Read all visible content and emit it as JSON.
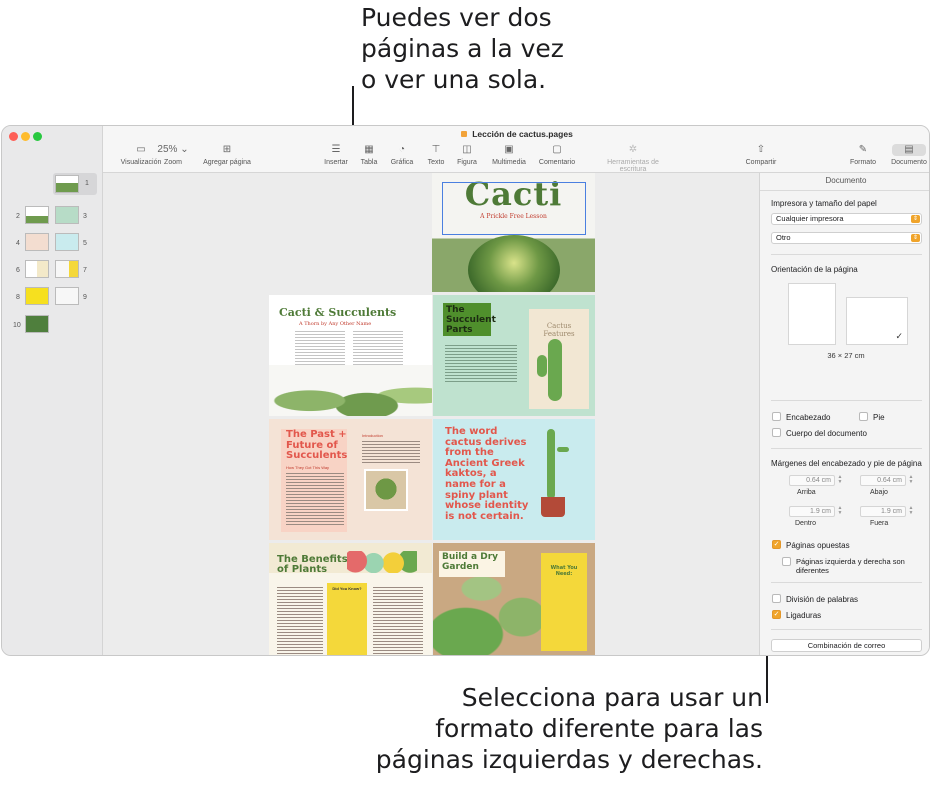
{
  "callouts": {
    "top": "Puedes ver dos\npáginas a la vez\no ver una sola.",
    "bottom": "Selecciona para usar un\nformato diferente para las\npáginas izquierdas y derechas."
  },
  "window": {
    "title": "Lección de cactus.pages",
    "traffic_colors": [
      "#fe5f57",
      "#febc2e",
      "#28c840"
    ]
  },
  "toolbar": {
    "items": [
      {
        "label": "Visualización",
        "icon": "sidebar-icon",
        "glyph": "▭"
      },
      {
        "label": "Zoom",
        "icon": "zoom-dropdown",
        "glyph": "25% ⌄"
      },
      {
        "label": "Agregar página",
        "icon": "add-page-icon",
        "glyph": "⊞"
      },
      {
        "label": "Insertar",
        "icon": "insert-icon",
        "glyph": "☰"
      },
      {
        "label": "Tabla",
        "icon": "table-icon",
        "glyph": "▦"
      },
      {
        "label": "Gráfica",
        "icon": "chart-icon",
        "glyph": "◔"
      },
      {
        "label": "Texto",
        "icon": "text-box-icon",
        "glyph": "⊤"
      },
      {
        "label": "Figura",
        "icon": "shape-icon",
        "glyph": "◫"
      },
      {
        "label": "Multimedia",
        "icon": "media-icon",
        "glyph": "▣"
      },
      {
        "label": "Comentario",
        "icon": "comment-icon",
        "glyph": "▢"
      },
      {
        "label": "Herramientas de escritura",
        "icon": "writing-tools-icon",
        "glyph": "✲",
        "disabled": true
      },
      {
        "label": "Compartir",
        "icon": "share-icon",
        "glyph": "⇧"
      },
      {
        "label": "Formato",
        "icon": "format-brush-icon",
        "glyph": "✎"
      },
      {
        "label": "Documento",
        "icon": "document-icon",
        "glyph": "▤",
        "active": true
      }
    ]
  },
  "sidebar": {
    "page_numbers": [
      "1",
      "2",
      "3",
      "4",
      "5",
      "6",
      "7",
      "8",
      "9",
      "10"
    ]
  },
  "pages": {
    "cover": {
      "title": "Cacti",
      "subtitle": "A Prickle Free Lesson"
    },
    "p2": {
      "title": "Cacti & Succulents",
      "subtitle": "A Thorn by Any Other Name"
    },
    "p3": {
      "title": "The Succulent Parts",
      "label": "Cactus Features"
    },
    "p4": {
      "title": "The Past + Future of Succulents",
      "sub": "How They Got This Way",
      "side": "Introduction"
    },
    "p5": {
      "text": "The word cactus derives from the Ancient Greek kaktos, a name for a spiny plant whose identity is not certain."
    },
    "p6": {
      "title": "The Benefits of Plants",
      "box": "Did You Know?"
    },
    "p7": {
      "title": "Build a Dry Garden",
      "panel": "What You Need:"
    }
  },
  "inspector": {
    "header": "Documento",
    "printer_section": "Impresora y tamaño del papel",
    "printer_value": "Cualquier impresora",
    "paper_value": "Otro",
    "orientation_section": "Orientación de la página",
    "page_size": "36 × 27 cm",
    "header_label": "Encabezado",
    "footer_label": "Pie",
    "body_label": "Cuerpo del documento",
    "margins_section": "Márgenes del encabezado y pie de página",
    "top_value": "0.64 cm",
    "top_label": "Arriba",
    "bottom_value": "0.64 cm",
    "bottom_label": "Abajo",
    "inside_value": "1.9 cm",
    "inside_label": "Dentro",
    "outside_value": "1.9 cm",
    "outside_label": "Fuera",
    "facing_label": "Páginas opuestas",
    "left_right_label": "Páginas izquierda y derecha son diferentes",
    "hyphen_label": "División de palabras",
    "ligatures_label": "Ligaduras",
    "mail_merge_button": "Combinación de correo",
    "checkbox_states": {
      "header": false,
      "footer": false,
      "body": false,
      "facing": true,
      "left_right": false,
      "hyphen": false,
      "ligatures": true
    }
  }
}
